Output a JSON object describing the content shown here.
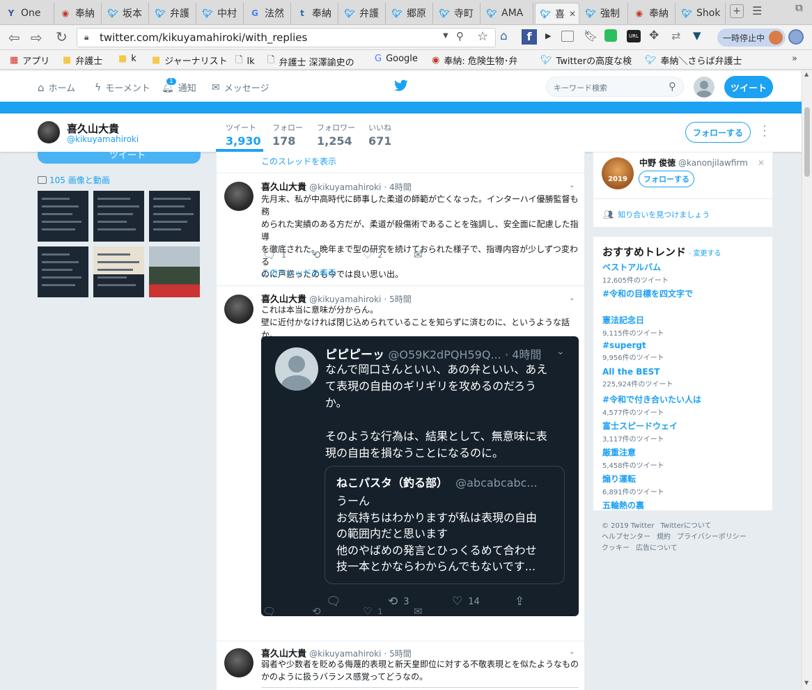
{
  "browser": {
    "tabs": [
      {
        "label": "One",
        "icon": "y-icon",
        "color": "#3b5998"
      },
      {
        "label": "奉納",
        "icon": "fox-icon",
        "color": "#c0392b"
      },
      {
        "label": "坂本",
        "icon": "twitter-icon",
        "color": "#1da1f2"
      },
      {
        "label": "弁護",
        "icon": "twitter-icon",
        "color": "#1da1f2"
      },
      {
        "label": "中村",
        "icon": "twitter-icon",
        "color": "#1da1f2"
      },
      {
        "label": "法然",
        "icon": "google-icon",
        "color": "#4285f4"
      },
      {
        "label": "奉納",
        "icon": "t-icon",
        "color": "#2b6cb0"
      },
      {
        "label": "弁護",
        "icon": "twitter-icon",
        "color": "#1da1f2"
      },
      {
        "label": "郷原",
        "icon": "twitter-icon",
        "color": "#1da1f2"
      },
      {
        "label": "寺町",
        "icon": "twitter-icon",
        "color": "#1da1f2"
      },
      {
        "label": "AMA",
        "icon": "twitter-icon",
        "color": "#1da1f2"
      },
      {
        "label": "喜",
        "icon": "twitter-icon",
        "color": "#1da1f2"
      },
      {
        "label": "強制",
        "icon": "twitter-icon",
        "color": "#1da1f2"
      },
      {
        "label": "奉納",
        "icon": "fox-icon",
        "color": "#c0392b"
      },
      {
        "label": "Shok",
        "icon": "twitter-icon",
        "color": "#1da1f2"
      }
    ],
    "url": "twitter.com/kikuyamahiroki/with_replies",
    "pause_label": "一時停止中",
    "bookmarks": [
      {
        "label": "アプリ",
        "icon": "apps-icon"
      },
      {
        "label": "弁護士",
        "icon": "folder-icon"
      },
      {
        "label": "k",
        "icon": "folder-icon"
      },
      {
        "label": "ジャーナリスト",
        "icon": "folder-icon"
      },
      {
        "label": "lk",
        "icon": "page-icon"
      },
      {
        "label": "弁護士 深澤諭史の",
        "icon": "page-icon"
      },
      {
        "label": "Google",
        "icon": "google-icon"
      },
      {
        "label": "奉納: 危険生物･弁",
        "icon": "fox-icon"
      },
      {
        "label": "Twitterの高度な検",
        "icon": "twitter-icon"
      },
      {
        "label": "奉納＼さらば弁護士",
        "icon": "twitter-icon"
      }
    ]
  },
  "nav": {
    "home": "ホーム",
    "moments": "モーメント",
    "notifications": "通知",
    "notif_count": "1",
    "messages": "メッセージ",
    "search_placeholder": "キーワード検索",
    "tweet_button": "ツイート"
  },
  "profile": {
    "name": "喜久山大貴",
    "handle": "@kikuyamahiroki",
    "stats": [
      {
        "label": "ツイート",
        "value": "3,930"
      },
      {
        "label": "フォロー",
        "value": "178"
      },
      {
        "label": "フォロワー",
        "value": "1,254"
      },
      {
        "label": "いいね",
        "value": "671"
      }
    ],
    "follow_button": "フォローする"
  },
  "left": {
    "tweet_button": "ツイート",
    "media_label": "105 画像と動画"
  },
  "timeline": {
    "show_thread_top": "このスレッドを表示",
    "tweets": [
      {
        "name": "喜久山大貴",
        "handle": "@kikuyamahiroki",
        "time": "· 4時間",
        "lines": [
          "先月末、私が中高時代に師事した柔道の師範が亡くなった。インターハイ優勝監督も務",
          "められた実績のある方だが、柔道が殺傷術であることを強調し、安全面に配慮した指導",
          "を徹底された。晩年まで型の研究を続けておられた様子で、指導内容が少しずつ変わる",
          "のに戸惑ったのも今では良い思い出。"
        ],
        "replies": "1",
        "retweets": "",
        "likes": "2",
        "show_thread": "このスレッドを表示"
      },
      {
        "name": "喜久山大貴",
        "handle": "@kikuyamahiroki",
        "time": "· 5時間",
        "lines": [
          "これは本当に意味が分からん。",
          "壁に近付かなければ閉じ込められていることを知らずに済むのに、というような話か。"
        ],
        "replies": "",
        "retweets": "",
        "likes": "1"
      },
      {
        "name": "喜久山大貴",
        "handle": "@kikuyamahiroki",
        "time": "· 5時間",
        "lines": [
          "弱者や少数者を貶める侮蔑的表現と新天皇即位に対する不敬表現とを似たようなもの",
          "かのように扱うバランス感覚ってどうなの。"
        ]
      }
    ],
    "quoted": {
      "name": "ピピピーッ",
      "handle": "@O59K2dPQH59Q...",
      "time": "· 4時間",
      "lines": [
        "なんで岡口さんといい、あの弁といい、あえ",
        "て表現の自由のギリギリを攻めるのだろう",
        "か。",
        "",
        "そのような行為は、結果として、無意味に表",
        "現の自由を損なうことになるのに。"
      ],
      "retweets": "3",
      "likes": "14",
      "inner": {
        "name": "ねこパスタ（釣る部）",
        "handle": "@abcabcabc...",
        "lines": [
          "うーん",
          "お気持ちはわかりますが私は表現の自由",
          "の範囲内だと思います",
          "他のやばめの発言とひっくるめて合わせ",
          "技一本とかならわからんでもないです..."
        ]
      }
    }
  },
  "right": {
    "suggest": {
      "name": "中野 俊徳",
      "handle": "@kanonjilawfirm",
      "follow": "フォローする",
      "avatar_text": "2019"
    },
    "find_friends": "知り合いを見つけましょう",
    "trends_title": "おすすめトレンド",
    "trends_change": "· 変更する",
    "trends": [
      {
        "name": "ベストアルバム",
        "count": "12,605件のツイート"
      },
      {
        "name": "#令和の目標を四文字で",
        "count": ""
      },
      {
        "name": "憲法記念日",
        "count": "9,115件のツイート"
      },
      {
        "name": "#supergt",
        "count": "9,956件のツイート"
      },
      {
        "name": "All the BEST",
        "count": "225,924件のツイート"
      },
      {
        "name": "#令和で付き合いたい人は",
        "count": "4,577件のツイート"
      },
      {
        "name": "富士スピードウェイ",
        "count": "3,117件のツイート"
      },
      {
        "name": "厳重注意",
        "count": "5,458件のツイート"
      },
      {
        "name": "煽り運転",
        "count": "6,891件のツイート"
      },
      {
        "name": "五輪熱の裏",
        "count": ""
      }
    ],
    "footer": [
      [
        "© 2019 Twitter",
        "Twitterについて"
      ],
      [
        "ヘルプセンター",
        "規約",
        "プライバシーポリシー"
      ],
      [
        "クッキー",
        "広告について"
      ]
    ]
  }
}
